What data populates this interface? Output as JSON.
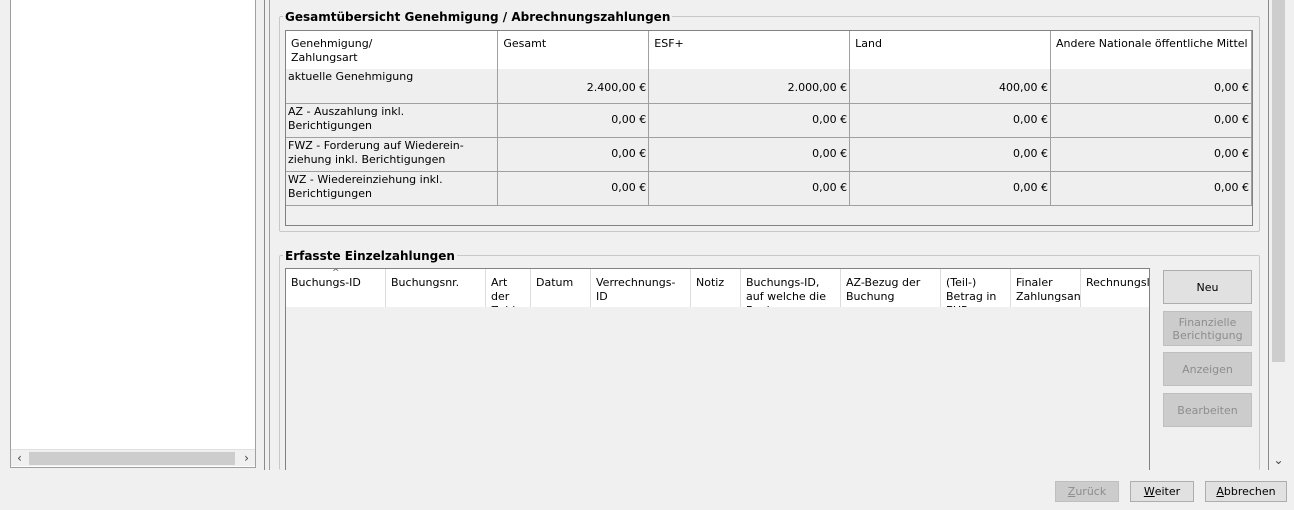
{
  "overview": {
    "title": "Gesamtübersicht Genehmigung / Abrechnungszahlungen",
    "columns": [
      "Genehmigung/\nZahlungsart",
      "Gesamt",
      "ESF+",
      "Land",
      "Andere Nationale öffentliche Mittel"
    ],
    "rows": [
      {
        "label": "aktuelle Genehmigung",
        "values": [
          "2.400,00 €",
          "2.000,00 €",
          "400,00 €",
          "0,00 €"
        ]
      },
      {
        "label": "AZ - Auszahlung inkl.\nBerichtigungen",
        "values": [
          "0,00 €",
          "0,00 €",
          "0,00 €",
          "0,00 €"
        ]
      },
      {
        "label": "FWZ - Forderung auf Wiederein-\nziehung inkl. Berichtigungen",
        "values": [
          "0,00 €",
          "0,00 €",
          "0,00 €",
          "0,00 €"
        ]
      },
      {
        "label": "WZ - Wiedereinziehung inkl.\nBerichtigungen",
        "values": [
          "0,00 €",
          "0,00 €",
          "0,00 €",
          "0,00 €"
        ]
      }
    ]
  },
  "payments": {
    "title": "Erfasste Einzelzahlungen",
    "columns": [
      "Buchungs-ID",
      "Buchungsnr.",
      "Art der Zahlung",
      "Datum",
      "Verrechnungs-ID",
      "Notiz",
      "Buchungs-ID, auf welche die Buchung",
      "AZ-Bezug der Buchung",
      "(Teil-) Betrag in EUR",
      "Finaler Zahlungsantrag",
      "Rechnungslegung"
    ],
    "buttons": {
      "new": "Neu",
      "financial_correction": "Finanzielle Berichtigung",
      "show": "Anzeigen",
      "edit": "Bearbeiten"
    }
  },
  "footer": {
    "back_first": "Z",
    "back_rest": "urück",
    "next_first": "W",
    "next_rest": "eiter",
    "cancel_first": "A",
    "cancel_rest": "bbrechen"
  }
}
